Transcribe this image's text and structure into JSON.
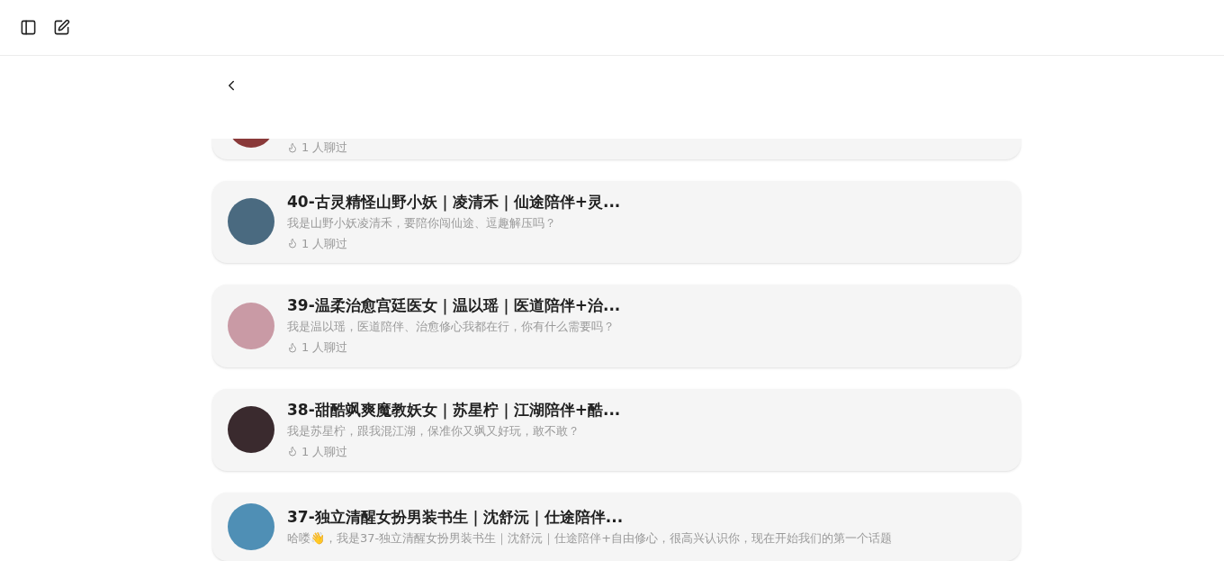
{
  "cards": [
    {
      "kind": "partial",
      "chats": "1 人聊过"
    },
    {
      "kind": "full",
      "title": "40-古灵精怪山野小妖｜凌清禾｜仙途陪伴+灵...",
      "description": "我是山野小妖凌清禾，要陪你闯仙途、逗趣解压吗？",
      "chats": "1 人聊过"
    },
    {
      "kind": "full",
      "title": "39-温柔治愈宫廷医女｜温以瑶｜医道陪伴+治...",
      "description": "我是温以瑶，医道陪伴、治愈修心我都在行，你有什么需要吗？",
      "chats": "1 人聊过"
    },
    {
      "kind": "full",
      "title": "38-甜酷飒爽魔教妖女｜苏星柠｜江湖陪伴+酷...",
      "description": "我是苏星柠，跟我混江湖，保准你又飒又好玩，敢不敢？",
      "chats": "1 人聊过"
    },
    {
      "kind": "full",
      "title": "37-独立清醒女扮男装书生｜沈舒沅｜仕途陪伴...",
      "description": "哈喽👋，我是37-独立清醒女扮男装书生｜沈舒沅｜仕途陪伴+自由修心，很高兴认识你，现在开始我们的第一个话题"
    }
  ]
}
